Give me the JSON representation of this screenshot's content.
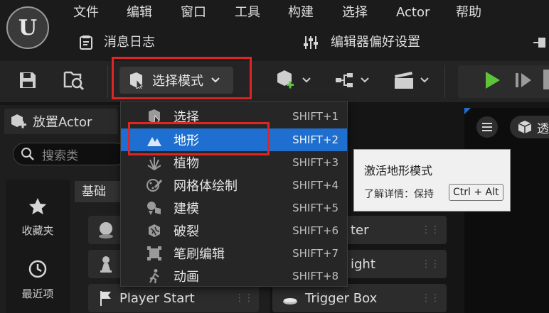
{
  "menubar": {
    "items": [
      "文件",
      "编辑",
      "窗口",
      "工具",
      "构建",
      "选择",
      "Actor",
      "帮助"
    ],
    "message_log": "消息日志",
    "editor_prefs": "编辑器偏好设置"
  },
  "toolbar": {
    "mode_label": "选择模式"
  },
  "place_actor": {
    "tab_title": "放置Actor",
    "search_placeholder": "搜索类",
    "categories": [
      {
        "label": "收藏夹",
        "icon": "star-icon"
      },
      {
        "label": "最近项",
        "icon": "clock-icon"
      }
    ],
    "section_title": "基础",
    "items": [
      {
        "label": "ter",
        "icon": "sphere-icon"
      },
      {
        "label": "ight",
        "icon": "pawn-icon"
      },
      {
        "label": "Player Start",
        "icon": "flag-icon"
      },
      {
        "label": "Trigger Box",
        "icon": "box-icon"
      }
    ]
  },
  "mode_menu": {
    "items": [
      {
        "label": "选择",
        "shortcut": "SHIFT+1",
        "icon": "select-icon",
        "selected": false
      },
      {
        "label": "地形",
        "shortcut": "SHIFT+2",
        "icon": "landscape-icon",
        "selected": true
      },
      {
        "label": "植物",
        "shortcut": "SHIFT+3",
        "icon": "foliage-icon",
        "selected": false
      },
      {
        "label": "网格体绘制",
        "shortcut": "SHIFT+4",
        "icon": "paint-icon",
        "selected": false
      },
      {
        "label": "建模",
        "shortcut": "SHIFT+5",
        "icon": "modeling-icon",
        "selected": false
      },
      {
        "label": "破裂",
        "shortcut": "SHIFT+6",
        "icon": "fracture-icon",
        "selected": false
      },
      {
        "label": "笔刷编辑",
        "shortcut": "SHIFT+7",
        "icon": "brush-icon",
        "selected": false
      },
      {
        "label": "动画",
        "shortcut": "SHIFT+8",
        "icon": "animation-icon",
        "selected": false
      }
    ]
  },
  "tooltip": {
    "title": "激活地形模式",
    "detail": "了解详情：保持",
    "key_hint": "Ctrl + Alt"
  },
  "viewport": {
    "view_label": "透"
  },
  "colors": {
    "highlight_red": "#e02525",
    "selection_blue": "#1f6fd0",
    "play_green": "#5ec23a"
  }
}
